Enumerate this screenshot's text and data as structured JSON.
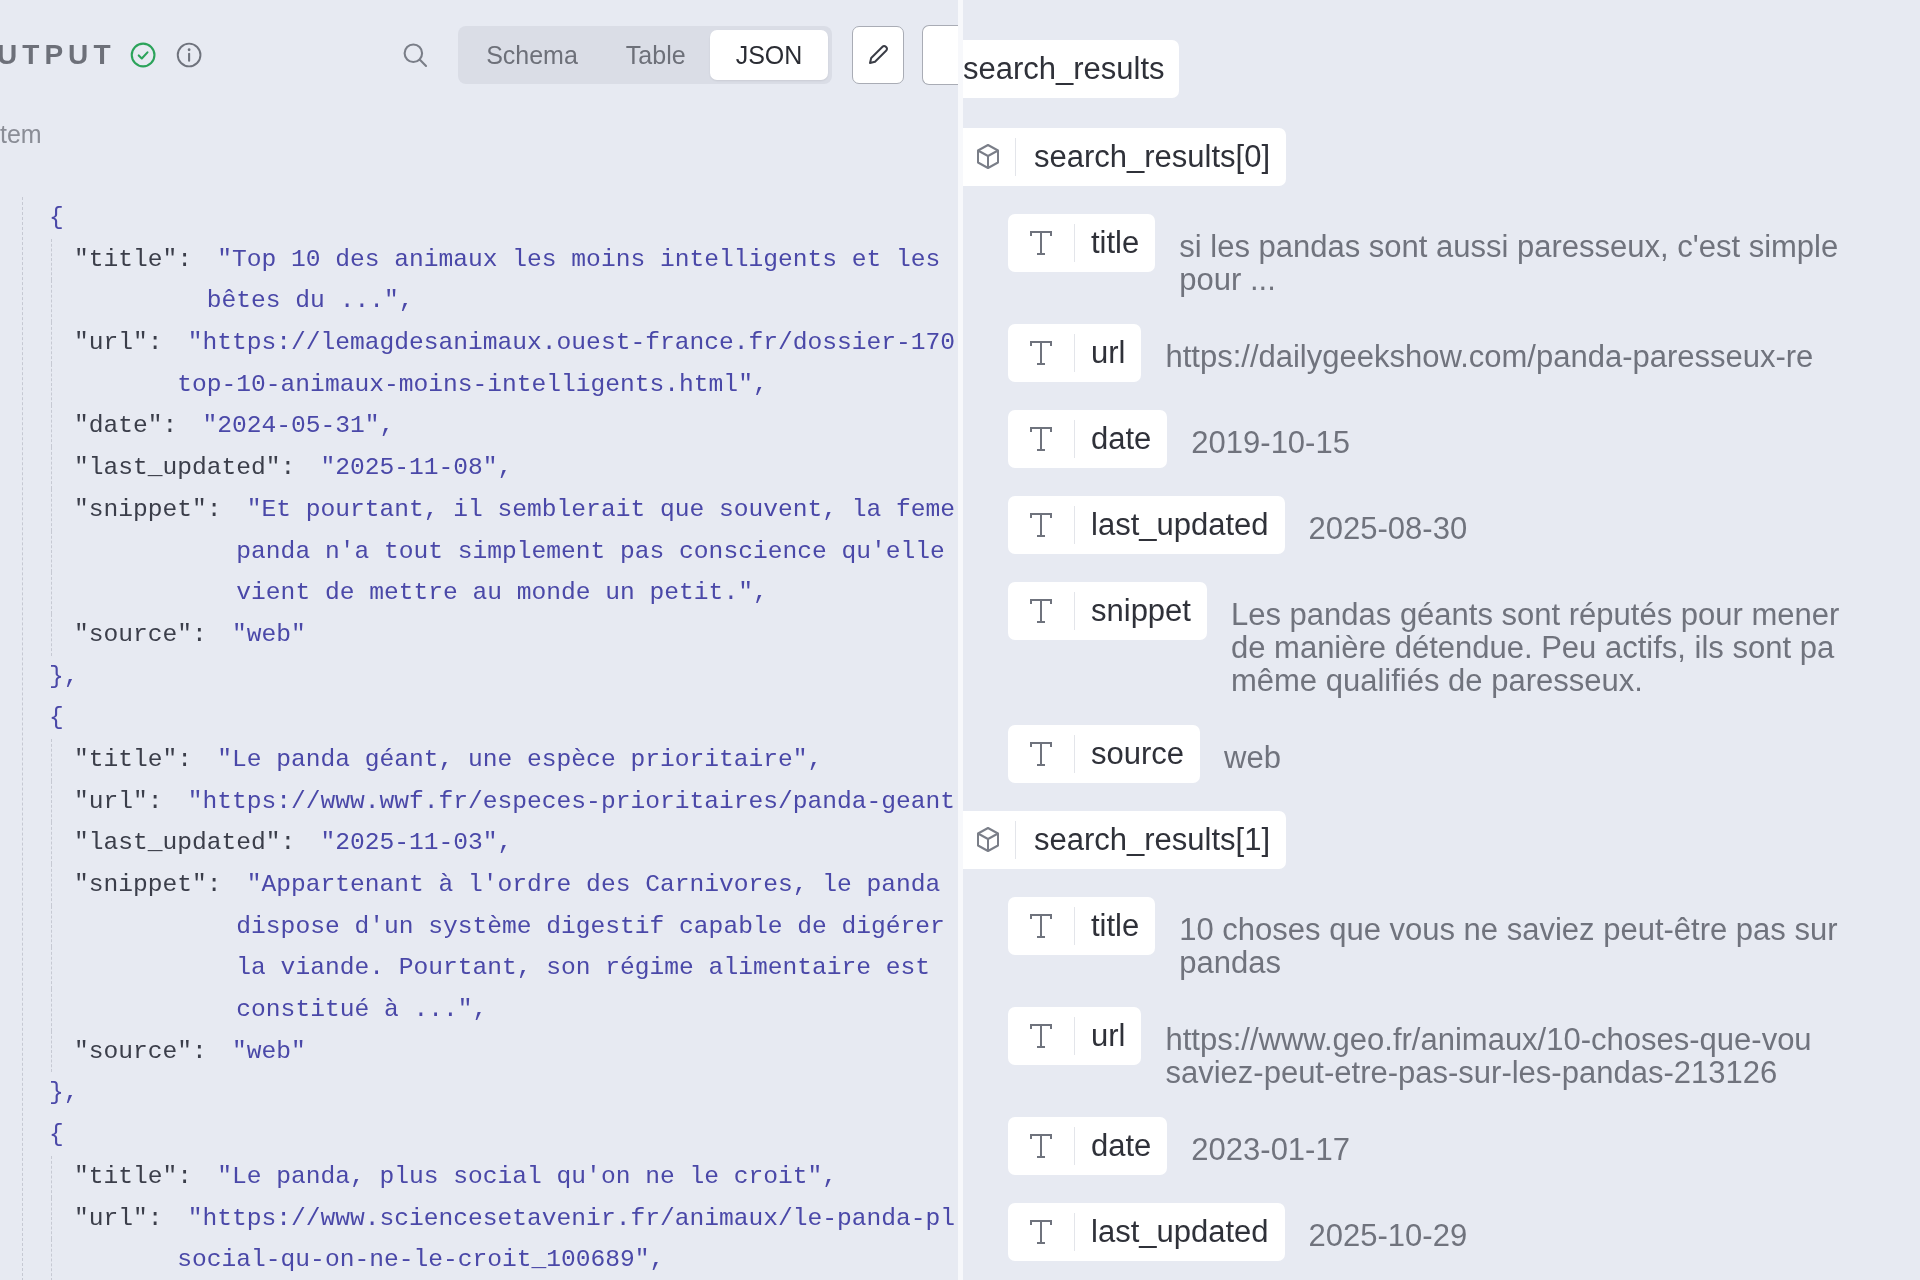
{
  "output_panel": {
    "title": "UTPUT",
    "tabs": [
      {
        "label": "Schema",
        "selected": false
      },
      {
        "label": "Table",
        "selected": false
      },
      {
        "label": "JSON",
        "selected": true
      }
    ],
    "breadcrumb": "tem",
    "code_lines": [
      {
        "kind": "open",
        "text": "{"
      },
      {
        "kind": "field",
        "key": "\"title\":",
        "value": "\"Top 10 des animaux les moins intelligents et les"
      },
      {
        "kind": "wrap",
        "value": "bêtes du ...\","
      },
      {
        "kind": "field",
        "key": "\"url\":",
        "value": "\"https://lemagdesanimaux.ouest-france.fr/dossier-170"
      },
      {
        "kind": "wrap",
        "value": "top-10-animaux-moins-intelligents.html\","
      },
      {
        "kind": "field",
        "key": "\"date\":",
        "value": "\"2024-05-31\","
      },
      {
        "kind": "field",
        "key": "\"last_updated\":",
        "value": "\"2025-11-08\","
      },
      {
        "kind": "field",
        "key": "\"snippet\":",
        "value": "\"Et pourtant, il semblerait que souvent, la feme"
      },
      {
        "kind": "wrap",
        "value": "panda n'a tout simplement pas conscience qu'elle"
      },
      {
        "kind": "wrap",
        "value": "vient de mettre au monde un petit.\","
      },
      {
        "kind": "field",
        "key": "\"source\":",
        "value": "\"web\""
      },
      {
        "kind": "close",
        "text": "},"
      },
      {
        "kind": "open",
        "text": "{"
      },
      {
        "kind": "field",
        "key": "\"title\":",
        "value": "\"Le panda géant, une espèce prioritaire\","
      },
      {
        "kind": "field",
        "key": "\"url\":",
        "value": "\"https://www.wwf.fr/especes-prioritaires/panda-geant"
      },
      {
        "kind": "field",
        "key": "\"last_updated\":",
        "value": "\"2025-11-03\","
      },
      {
        "kind": "field",
        "key": "\"snippet\":",
        "value": "\"Appartenant à l'ordre des Carnivores, le panda"
      },
      {
        "kind": "wrap",
        "value": "dispose d'un système digestif capable de digérer"
      },
      {
        "kind": "wrap",
        "value": "la viande. Pourtant, son régime alimentaire est"
      },
      {
        "kind": "wrap",
        "value": "constitué à ...\","
      },
      {
        "kind": "field",
        "key": "\"source\":",
        "value": "\"web\""
      },
      {
        "kind": "close",
        "text": "},"
      },
      {
        "kind": "open",
        "text": "{"
      },
      {
        "kind": "field",
        "key": "\"title\":",
        "value": "\"Le panda, plus social qu'on ne le croit\","
      },
      {
        "kind": "field",
        "key": "\"url\":",
        "value": "\"https://www.sciencesetavenir.fr/animaux/le-panda-pl"
      },
      {
        "kind": "wrap",
        "value": "social-qu-on-ne-le-croit_100689\","
      }
    ]
  },
  "tree": {
    "root": "search_results",
    "items": [
      {
        "label": "search_results[0]",
        "fields": [
          {
            "kind": "string",
            "name": "title",
            "lines": [
              "si les pandas sont aussi paresseux, c'est simple",
              "pour ..."
            ]
          },
          {
            "kind": "string",
            "name": "url",
            "lines": [
              "https://dailygeekshow.com/panda-paresseux-re"
            ]
          },
          {
            "kind": "string",
            "name": "date",
            "lines": [
              "2019-10-15"
            ]
          },
          {
            "kind": "string",
            "name": "last_updated",
            "lines": [
              "2025-08-30"
            ]
          },
          {
            "kind": "string",
            "name": "snippet",
            "lines": [
              "Les pandas géants sont réputés pour mener",
              "de manière détendue. Peu actifs, ils sont pa",
              "même qualifiés de paresseux."
            ]
          },
          {
            "kind": "string",
            "name": "source",
            "lines": [
              "web"
            ]
          }
        ]
      },
      {
        "label": "search_results[1]",
        "fields": [
          {
            "kind": "string",
            "name": "title",
            "lines": [
              "10 choses que vous ne saviez peut-être pas sur",
              "pandas"
            ]
          },
          {
            "kind": "string",
            "name": "url",
            "lines": [
              "https://www.geo.fr/animaux/10-choses-que-vou",
              "saviez-peut-etre-pas-sur-les-pandas-213126"
            ]
          },
          {
            "kind": "string",
            "name": "date",
            "lines": [
              "2023-01-17"
            ]
          },
          {
            "kind": "string",
            "name": "last_updated",
            "lines": [
              "2025-10-29"
            ]
          }
        ]
      }
    ]
  }
}
